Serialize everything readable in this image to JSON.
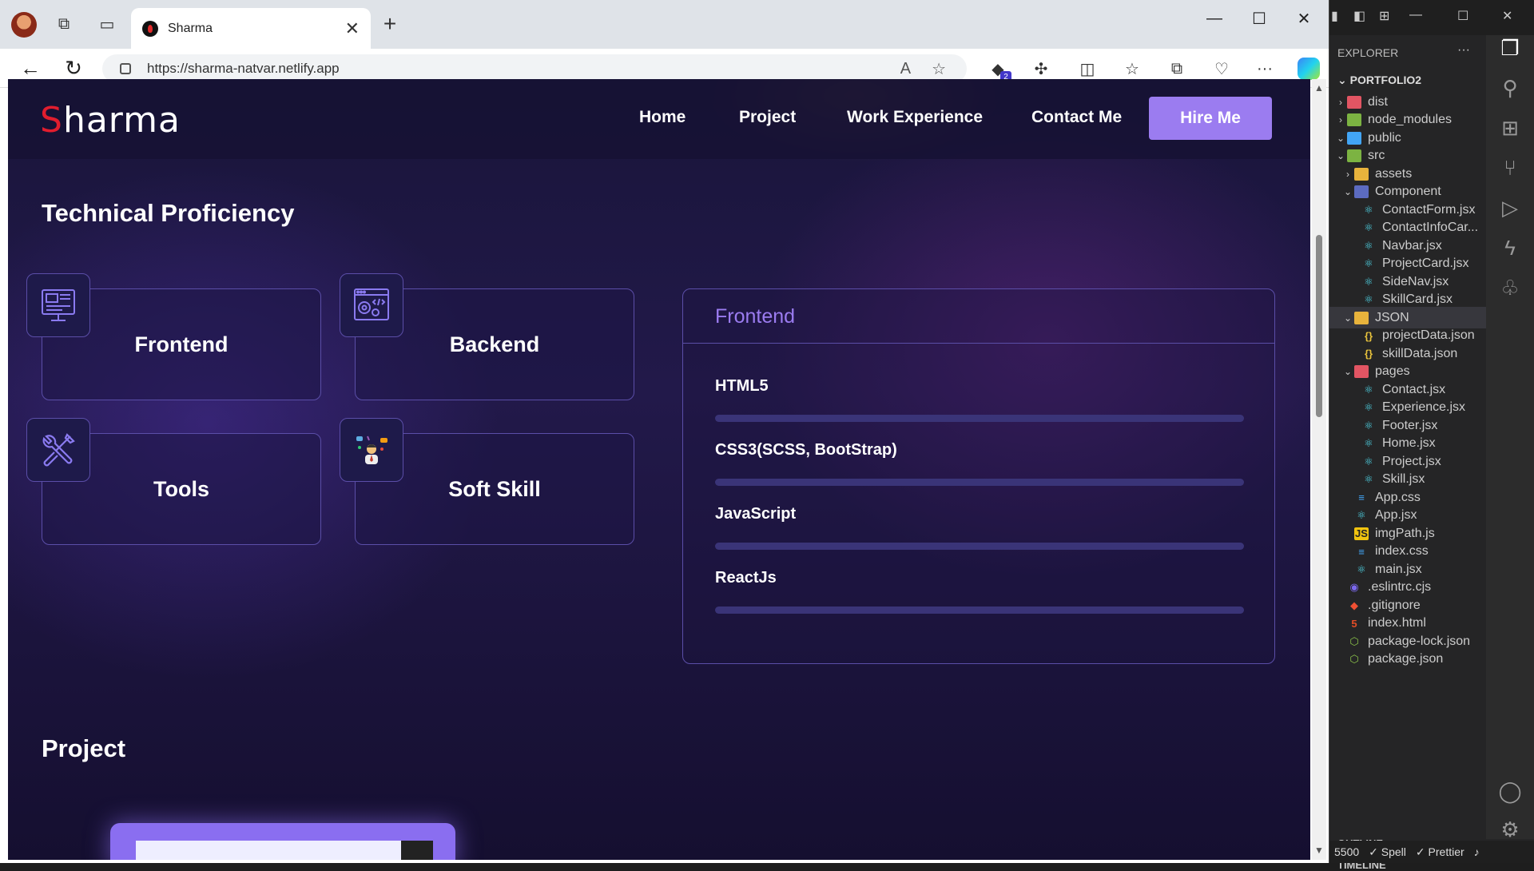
{
  "browser": {
    "tab_title": "Sharma",
    "tab_close": "✕",
    "new_tab": "+",
    "url": "https://sharma-natvar.netlify.app",
    "extension_badge": "2",
    "window_controls": {
      "minimize": "—",
      "maximize": "☐",
      "close": "✕"
    }
  },
  "site": {
    "brand_first": "S",
    "brand_rest": "harma",
    "nav": {
      "home": "Home",
      "project": "Project",
      "work_experience": "Work Experience",
      "contact": "Contact Me",
      "hire": "Hire Me"
    },
    "proficiency_title": "Technical Proficiency",
    "skill_cards": {
      "frontend": "Frontend",
      "backend": "Backend",
      "tools": "Tools",
      "soft_skill": "Soft Skill"
    },
    "detail_panel": {
      "title": "Frontend",
      "skills": [
        "HTML5",
        "CSS3(SCSS, BootStrap)",
        "JavaScript",
        "ReactJs"
      ]
    },
    "project_title": "Project"
  },
  "vscode": {
    "explorer_label": "EXPLORER",
    "explorer_more": "···",
    "root": "PORTFOLIO2",
    "tree": [
      {
        "label": "dist",
        "chev": "›",
        "icon": "folder-red"
      },
      {
        "label": "node_modules",
        "chev": "›",
        "icon": "folder-green"
      },
      {
        "label": "public",
        "chev": "⌄",
        "icon": "folder-blue"
      },
      {
        "label": "src",
        "chev": "⌄",
        "icon": "folder-green"
      },
      {
        "label": "assets",
        "chev": "›",
        "icon": "folder-yellow"
      },
      {
        "label": "Component",
        "chev": "⌄",
        "icon": "folder-cyan"
      },
      {
        "label": "ContactForm.jsx",
        "icon": "react"
      },
      {
        "label": "ContactInfoCar...",
        "icon": "react"
      },
      {
        "label": "Navbar.jsx",
        "icon": "react"
      },
      {
        "label": "ProjectCard.jsx",
        "icon": "react"
      },
      {
        "label": "SideNav.jsx",
        "icon": "react"
      },
      {
        "label": "SkillCard.jsx",
        "icon": "react"
      },
      {
        "label": "JSON",
        "chev": "⌄",
        "icon": "folder-yellow"
      },
      {
        "label": "projectData.json",
        "icon": "json"
      },
      {
        "label": "skillData.json",
        "icon": "json"
      },
      {
        "label": "pages",
        "chev": "⌄",
        "icon": "folder-red"
      },
      {
        "label": "Contact.jsx",
        "icon": "react"
      },
      {
        "label": "Experience.jsx",
        "icon": "react"
      },
      {
        "label": "Footer.jsx",
        "icon": "react"
      },
      {
        "label": "Home.jsx",
        "icon": "react"
      },
      {
        "label": "Project.jsx",
        "icon": "react"
      },
      {
        "label": "Skill.jsx",
        "icon": "react"
      },
      {
        "label": "App.css",
        "icon": "css"
      },
      {
        "label": "App.jsx",
        "icon": "react"
      },
      {
        "label": "imgPath.js",
        "icon": "js"
      },
      {
        "label": "index.css",
        "icon": "css"
      },
      {
        "label": "main.jsx",
        "icon": "react"
      },
      {
        "label": ".eslintrc.cjs",
        "icon": "eslint"
      },
      {
        "label": ".gitignore",
        "icon": "git"
      },
      {
        "label": "index.html",
        "icon": "html"
      },
      {
        "label": "package-lock.json",
        "icon": "npm"
      },
      {
        "label": "package.json",
        "icon": "npm"
      }
    ],
    "selected_item": "JSON",
    "outline": "OUTLINE",
    "timeline": "TIMELINE",
    "status": {
      "port": "5500",
      "spell": "✓ Spell",
      "prettier": "✓ Prettier"
    }
  },
  "colors": {
    "accent": "#9b7cf0",
    "brand_red": "#e11d2e",
    "card_border": "#5b4ea8"
  }
}
